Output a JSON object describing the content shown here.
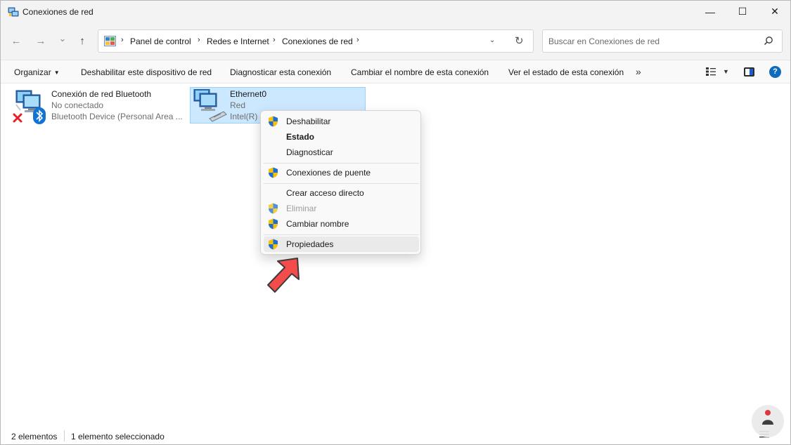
{
  "window": {
    "title": "Conexiones de red",
    "minimize_glyph": "—",
    "maximize_glyph": "☐",
    "close_glyph": "✕"
  },
  "nav": {
    "back_glyph": "←",
    "forward_glyph": "→",
    "recent_glyph": "⌄",
    "up_glyph": "↑",
    "breadcrumbs": [
      "Panel de control",
      "Redes e Internet",
      "Conexiones de red"
    ],
    "crumb_sep": "›",
    "dropdown_glyph": "⌄",
    "refresh_glyph": "↻"
  },
  "search": {
    "placeholder": "Buscar en Conexiones de red"
  },
  "toolbar": {
    "organize": "Organizar",
    "disable_device": "Deshabilitar este dispositivo de red",
    "diagnose": "Diagnosticar esta conexión",
    "rename": "Cambiar el nombre de esta conexión",
    "view_status": "Ver el estado de esta conexión",
    "more_glyph": "»",
    "help_glyph": "?"
  },
  "connections": [
    {
      "name": "Conexión de red Bluetooth",
      "status": "No conectado",
      "device": "Bluetooth Device (Personal Area ...",
      "selected": false
    },
    {
      "name": "Ethernet0",
      "status": "Red",
      "device": "Intel(R)",
      "selected": true
    }
  ],
  "context_menu": {
    "items": [
      {
        "label": "Deshabilitar",
        "shield": true,
        "bold": false,
        "disabled": false
      },
      {
        "label": "Estado",
        "shield": false,
        "bold": true,
        "disabled": false
      },
      {
        "label": "Diagnosticar",
        "shield": false,
        "bold": false,
        "disabled": false
      },
      {
        "label": "Conexiones de puente",
        "shield": true,
        "bold": false,
        "disabled": false
      },
      {
        "label": "Crear acceso directo",
        "shield": false,
        "bold": false,
        "disabled": false
      },
      {
        "label": "Eliminar",
        "shield": true,
        "bold": false,
        "disabled": true
      },
      {
        "label": "Cambiar nombre",
        "shield": true,
        "bold": false,
        "disabled": false
      },
      {
        "label": "Propiedades",
        "shield": true,
        "bold": false,
        "disabled": false,
        "hover": true
      }
    ]
  },
  "status": {
    "count": "2 elementos",
    "selection": "1 elemento seleccionado"
  },
  "colors": {
    "accent": "#0f6cbd",
    "selection_bg": "#cce8ff",
    "arrow": "#f44b4b",
    "error_x": "#e0232b",
    "bluetooth": "#1173d4"
  }
}
